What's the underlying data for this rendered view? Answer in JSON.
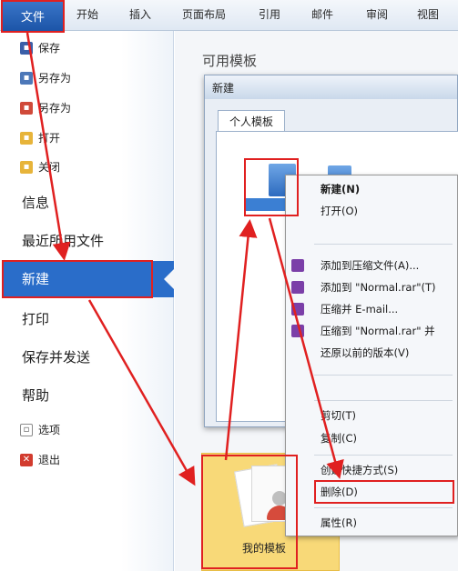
{
  "ribbon": {
    "file_tab": "文件",
    "tabs": [
      "开始",
      "插入",
      "页面布局",
      "引用",
      "邮件",
      "审阅",
      "视图"
    ]
  },
  "sidebar": {
    "small_items": [
      {
        "label": "保存",
        "icon": "save-icon"
      },
      {
        "label": "另存为",
        "icon": "save-as-icon"
      },
      {
        "label": "另存为",
        "icon": "save-as-pdf-icon"
      },
      {
        "label": "打开",
        "icon": "open-folder-icon"
      },
      {
        "label": "关闭",
        "icon": "close-folder-icon"
      }
    ],
    "info": "信息",
    "recent": "最近所用文件",
    "new": "新建",
    "print": "打印",
    "save_send": "保存并发送",
    "help": "帮助",
    "options": "选项",
    "exit": "退出"
  },
  "main": {
    "available_templates": "可用模板",
    "dialog_title": "新建",
    "tab_personal": "个人模板",
    "template_tile_label": "我的模板"
  },
  "context_menu": {
    "items": [
      "新建(N)",
      "打开(O)",
      "添加到压缩文件(A)...",
      "添加到 \"Normal.rar\"(T)",
      "压缩并 E-mail...",
      "压缩到 \"Normal.rar\" 并",
      "还原以前的版本(V)",
      "剪切(T)",
      "复制(C)",
      "创建快捷方式(S)",
      "删除(D)",
      "属性(R)"
    ]
  },
  "colors": {
    "accent": "#2a6dc9",
    "annotation": "#e02020",
    "tile": "#f8d978"
  }
}
